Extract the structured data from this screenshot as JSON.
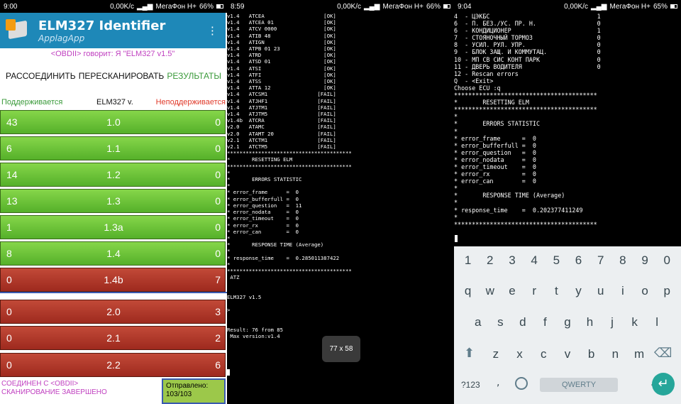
{
  "panel1": {
    "status": {
      "time": "9:00",
      "speed": "0,00K/c",
      "carrier": "МегаФон H+",
      "battery": "66%"
    },
    "app": {
      "title": "ELM327 Identifier",
      "subtitle": "ApplagApp"
    },
    "says": "<OBDII> говорит: Я \"ELM327 v1.5\"",
    "actions": {
      "disconnect": "РАССОЕДИНИТЬ",
      "rescan": "ПЕРЕСКАНИРОВАТЬ",
      "results": "РЕЗУЛЬТАТЫ"
    },
    "headers": {
      "supported": "Поддерживается",
      "version": "ELM327 v.",
      "unsupported": "Неподдерживается"
    },
    "rows": [
      {
        "sup": "43",
        "ver": "1.0",
        "uns": "0",
        "status": "ok"
      },
      {
        "sup": "6",
        "ver": "1.1",
        "uns": "0",
        "status": "ok"
      },
      {
        "sup": "14",
        "ver": "1.2",
        "uns": "0",
        "status": "ok"
      },
      {
        "sup": "13",
        "ver": "1.3",
        "uns": "0",
        "status": "ok"
      },
      {
        "sup": "1",
        "ver": "1.3a",
        "uns": "0",
        "status": "ok"
      },
      {
        "sup": "8",
        "ver": "1.4",
        "uns": "0",
        "status": "ok"
      },
      {
        "sup": "0",
        "ver": "1.4b",
        "uns": "7",
        "status": "fail"
      },
      {
        "sup": "0",
        "ver": "2.0",
        "uns": "3",
        "status": "fail"
      },
      {
        "sup": "0",
        "ver": "2.1",
        "uns": "2",
        "status": "fail"
      },
      {
        "sup": "0",
        "ver": "2.2",
        "uns": "6",
        "status": "fail"
      }
    ],
    "bottom": {
      "line1": "СОЕДИНЕН С <OBDII>",
      "line2": "СКАНИРОВАНИЕ ЗАВЕРШЕНО",
      "sent_label": "Отправлено:",
      "sent_value": "103/103"
    }
  },
  "panel2": {
    "status": {
      "time": "8:59",
      "speed": "0,00K/c",
      "carrier": "МегаФон H+",
      "battery": "66%"
    },
    "terminal": "v1.4   ATCEA                   [OK]\nv1.4   ATCEA 01                [OK]\nv1.4   ATCV 0000               [OK]\nv1.4   ATIB 48                 [OK]\nv1.4   ATIGN                   [OK]\nv1.4   ATPB 01 23              [OK]\nv1.4   ATRD                    [OK]\nv1.4   ATSD 01                 [OK]\nv1.4   ATSI                    [OK]\nv1.4   ATFI                    [OK]\nv1.4   ATSS                    [OK]\nv1.4   ATTA 12                 [OK]\nv1.4   ATCSM1                [FAIL]\nv1.4   ATJHF1                [FAIL]\nv1.4   ATJTM1                [FAIL]\nv1.4   ATJTM5                [FAIL]\nv1.4b  ATCRA                 [FAIL]\nv2.0   ATAMC                 [FAIL]\nv2.0   ATAMT 20              [FAIL]\nv2.1   ATCTM1                [FAIL]\nv2.1   ATCTM5                [FAIL]\n****************************************\n*       RESETTING ELM\n****************************************\n*\n*       ERRORS STATISTIC\n*\n* error_frame      =  0\n* error_bufferfull =  0\n* error_question   =  11\n* error_nodata     =  0\n* error_timeout    =  0\n* error_rx         =  0\n* error_can        =  0\n*\n*       RESPONSE TIME (Average)\n*\n* response_time    =  0.285011387422\n*\n****************************************\n ATZ\n\n\nELM327 v1.5\n\n>\n\n\nResult: 76 from 85\n Max version:v1.4",
    "toast": "77 x 58"
  },
  "panel3": {
    "status": {
      "time": "9:04",
      "speed": "0,00K/c",
      "carrier": "МегаФон H+",
      "battery": "65%"
    },
    "terminal": "4  - ЦЭКБС                              1\n6  - П. БЕЗ./УС. ПР. Н.                 0\n6  - КОНДИЦИОНЕР                        1\n7  - СТОЯНОЧНЫЙ ТОРМОЗ                  0\n8  - УСИЛ. РУЛ. УПР.                    0\n9  - БЛОК ЗАЩ. И КОММУТАЦ.              0\n10 - МП СВ СИС КОНТ ПАРК                0\n11 - ДВЕРЬ ВОДИТЕЛЯ                     0\n12 - Rescan errors\nQ  - <Exit>\nChoose ECU :q\n****************************************\n*       RESETTING ELM\n****************************************\n*\n*       ERRORS STATISTIC\n*\n* error_frame      =  0\n* error_bufferfull =  0\n* error_question   =  0\n* error_nodata     =  0\n* error_timeout    =  0\n* error_rx         =  0\n* error_can        =  0\n*\n*       RESPONSE TIME (Average)\n*\n* response_time    =  0.202377411249\n*\n****************************************",
    "keyboard": {
      "numbers": [
        "1",
        "2",
        "3",
        "4",
        "5",
        "6",
        "7",
        "8",
        "9",
        "0"
      ],
      "row1": [
        "q",
        "w",
        "e",
        "r",
        "t",
        "y",
        "u",
        "i",
        "o",
        "p"
      ],
      "row2": [
        "a",
        "s",
        "d",
        "f",
        "g",
        "h",
        "j",
        "k",
        "l"
      ],
      "row3": [
        "z",
        "x",
        "c",
        "v",
        "b",
        "n",
        "m"
      ],
      "k123": "?123",
      "comma": ",",
      "space": "QWERTY",
      "dot": "."
    }
  }
}
